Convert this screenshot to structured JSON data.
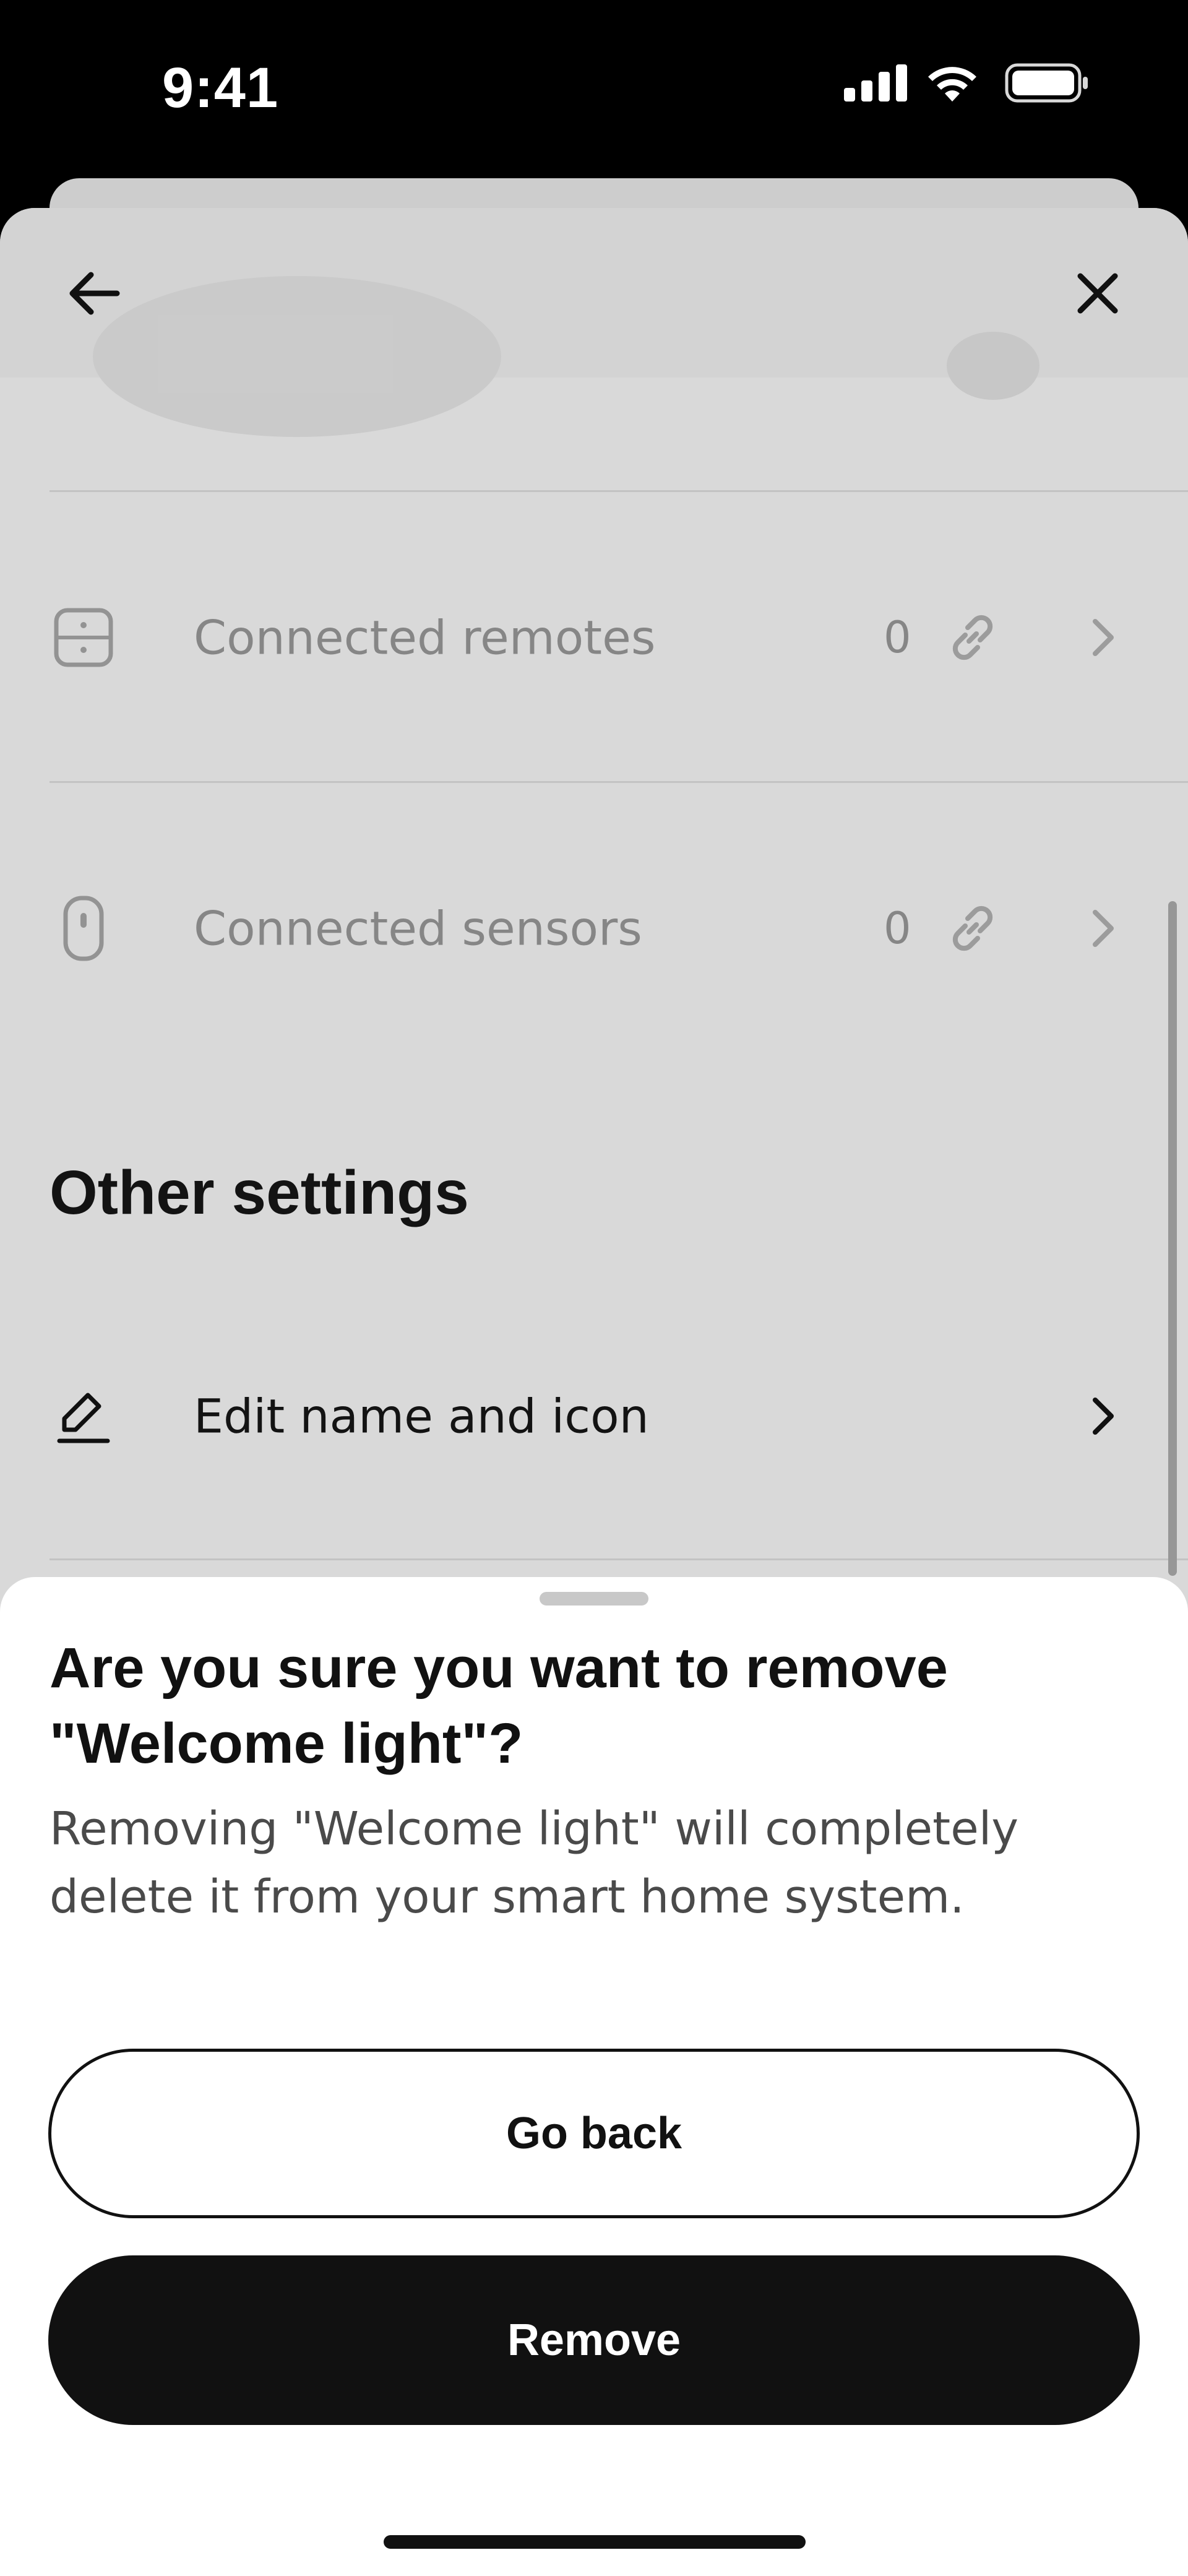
{
  "status_bar": {
    "time": "9:41"
  },
  "rows": [
    {
      "label": "Connected remotes",
      "count": "0",
      "icon": "remote-icon"
    },
    {
      "label": "Connected sensors",
      "count": "0",
      "icon": "sensor-icon"
    }
  ],
  "other_settings": {
    "title": "Other settings",
    "edit_label": "Edit name and icon"
  },
  "dialog": {
    "title": "Are you sure you want to remove \"Welcome light\"?",
    "body": "Removing \"Welcome light\" will completely delete it from your smart home system.",
    "go_back": "Go back",
    "remove": "Remove"
  },
  "colors": {
    "sheet_background": "#e2e2e2",
    "dialog_background": "#ffffff",
    "primary_button": "#111111",
    "muted_text": "#8c8c8c"
  }
}
